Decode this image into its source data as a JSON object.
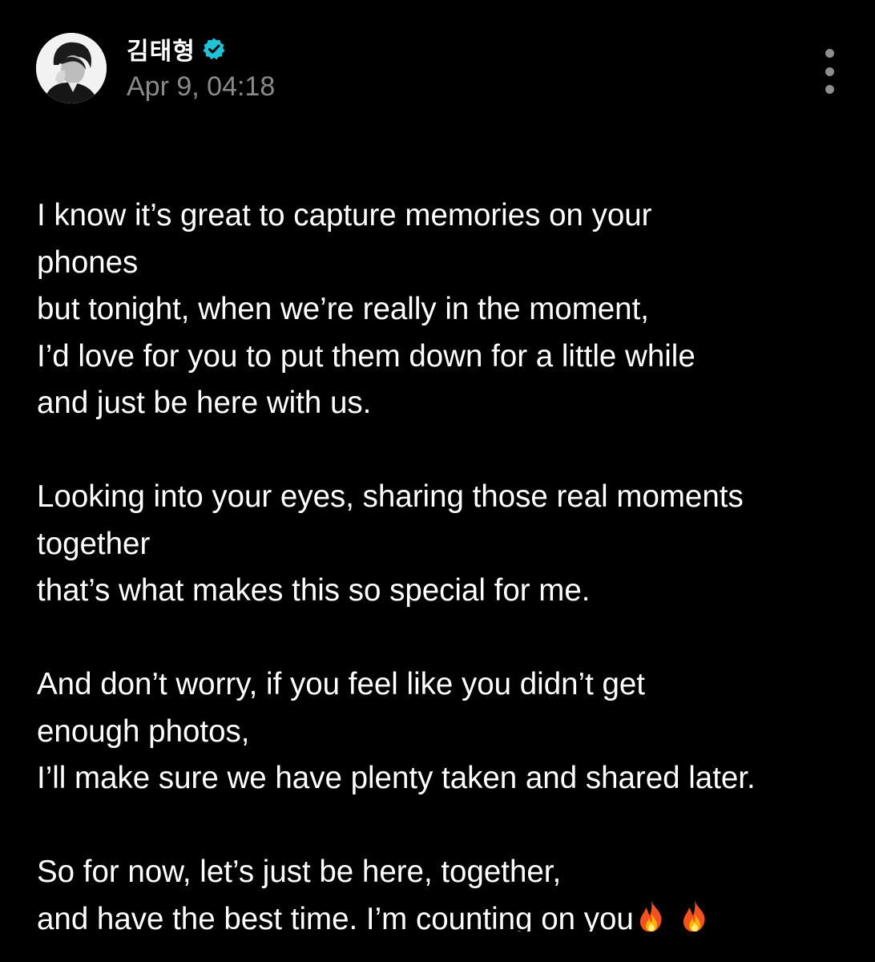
{
  "author": {
    "name": "김태형",
    "verified": true,
    "timestamp": "Apr 9, 04:18",
    "avatar_icon": "profile-photo"
  },
  "menu": {
    "icon": "more-vertical-icon"
  },
  "post": {
    "paragraph_1": [
      "I know it’s great to capture memories on your",
      "phones",
      "but tonight, when we’re really in the moment,",
      "I’d love for you to put them down for a little while",
      "and just be here with us."
    ],
    "paragraph_2": [
      "Looking into your eyes, sharing those real moments",
      "together",
      "that’s what makes this so special for me."
    ],
    "paragraph_3": [
      "And don’t worry, if you feel like you didn’t get",
      "enough photos,",
      "I’ll make sure we have plenty taken and shared later."
    ],
    "paragraph_4": [
      "So for now, let’s just be here, together,",
      "and have the best time. I’m counting on you"
    ],
    "trailing_emojis": [
      "fire-emoji",
      "fire-emoji"
    ]
  },
  "colors": {
    "background": "#000000",
    "text": "#ffffff",
    "timestamp": "#8a8a8a",
    "verified_badge": "#1ec3d8",
    "menu_dots": "#8e8e8e"
  }
}
